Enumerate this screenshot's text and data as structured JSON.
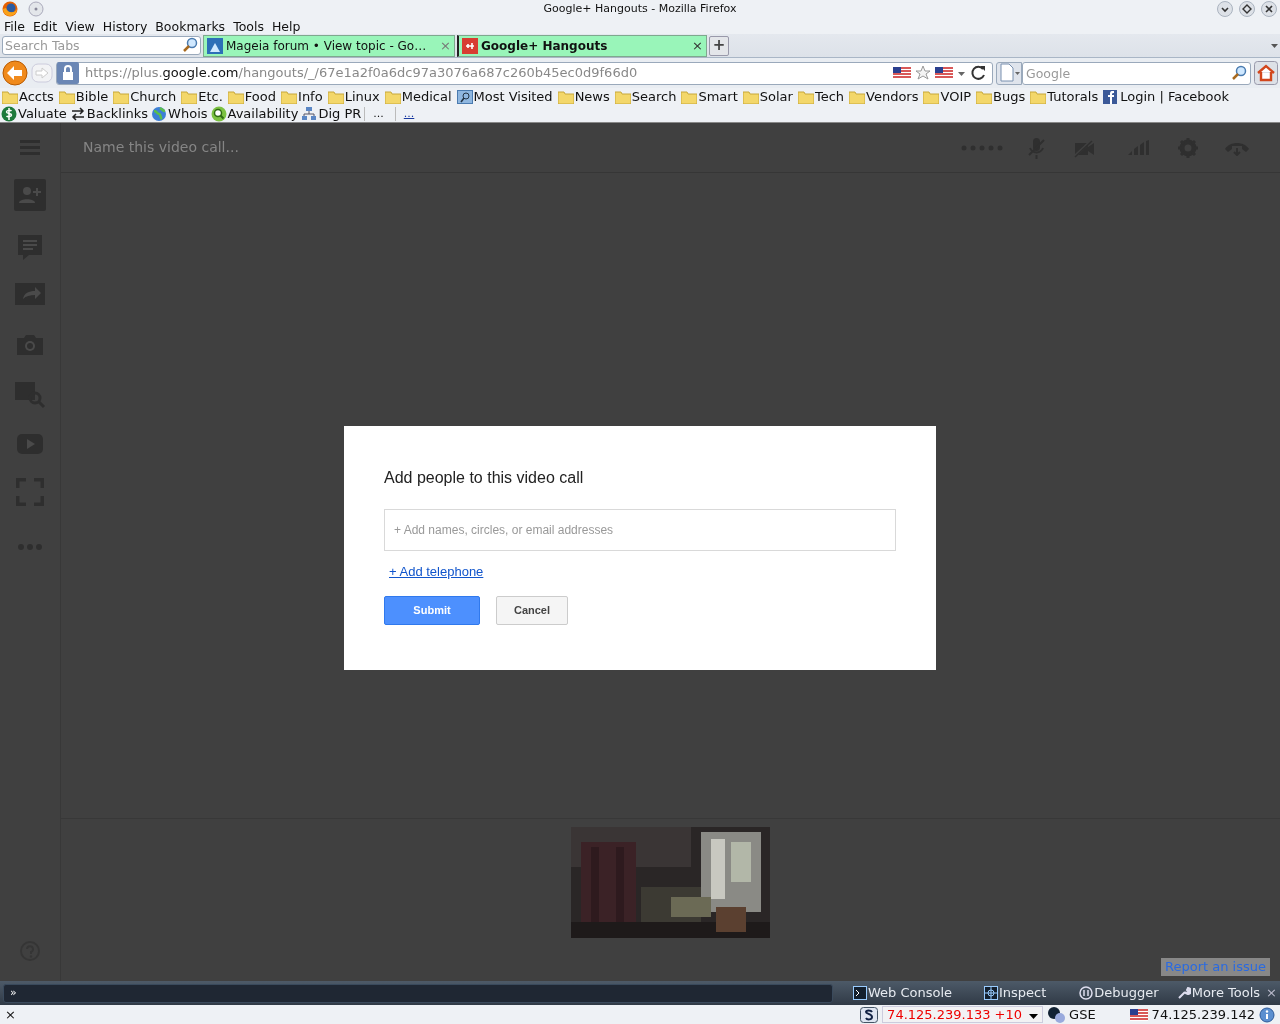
{
  "window": {
    "title": "Google+ Hangouts - Mozilla Firefox"
  },
  "menu": [
    "File",
    "Edit",
    "View",
    "History",
    "Bookmarks",
    "Tools",
    "Help"
  ],
  "tab_search": {
    "placeholder": "Search Tabs"
  },
  "tabs": [
    {
      "label": "Mageia forum • View topic - Go…",
      "close": "×",
      "selected": false
    },
    {
      "label": "Google+ Hangouts",
      "close": "×",
      "selected": true
    }
  ],
  "new_tab": "+",
  "address": {
    "prefix": "https://plus.",
    "domain": "google.com",
    "path": "/hangouts/_/67e1a2f0a6dc97a3076a687c260b45ec0d9f66d0"
  },
  "web_search": {
    "placeholder": "Google"
  },
  "bookmarks": [
    {
      "label": "Accts",
      "kind": "folder"
    },
    {
      "label": "Bible",
      "kind": "folder"
    },
    {
      "label": "Church",
      "kind": "folder"
    },
    {
      "label": "Etc.",
      "kind": "folder"
    },
    {
      "label": "Food",
      "kind": "folder"
    },
    {
      "label": "Info",
      "kind": "folder"
    },
    {
      "label": "Linux",
      "kind": "folder"
    },
    {
      "label": "Medical",
      "kind": "folder"
    },
    {
      "label": "Most Visited",
      "kind": "smart"
    },
    {
      "label": "News",
      "kind": "folder"
    },
    {
      "label": "Search",
      "kind": "folder"
    },
    {
      "label": "Smart",
      "kind": "folder"
    },
    {
      "label": "Solar",
      "kind": "folder"
    },
    {
      "label": "Tech",
      "kind": "folder"
    },
    {
      "label": "Vendors",
      "kind": "folder"
    },
    {
      "label": "VOIP",
      "kind": "folder"
    },
    {
      "label": "Bugs",
      "kind": "folder"
    },
    {
      "label": "Tutorals",
      "kind": "folder"
    },
    {
      "label": "Login | Facebook",
      "kind": "site"
    }
  ],
  "seo_tools": [
    {
      "label": "Valuate",
      "kind": "dollar"
    },
    {
      "label": "Backlinks",
      "kind": "swap"
    },
    {
      "label": "Whois",
      "kind": "globe"
    },
    {
      "label": "Availability",
      "kind": "magnifier"
    },
    {
      "label": "Dig PR",
      "kind": "network"
    }
  ],
  "overflow": [
    "...",
    "..."
  ],
  "hangout": {
    "call_name": {
      "placeholder": "Name this video call..."
    },
    "dialog": {
      "title": "Add people to this video call",
      "field": {
        "placeholder": "+ Add names, circles, or email addresses"
      },
      "link": "+ Add telephone",
      "buttons": [
        {
          "label": "Submit",
          "kind": "primary"
        },
        {
          "label": "Cancel",
          "kind": "secondary"
        }
      ]
    },
    "report": "Report an issue"
  },
  "devtools": {
    "prompt": "»",
    "buttons": [
      {
        "label": "Web Console",
        "kind": "console"
      },
      {
        "label": "Inspect",
        "kind": "inspect"
      },
      {
        "label": "Debugger",
        "kind": "debugger"
      },
      {
        "label": "More Tools",
        "kind": "tools"
      }
    ],
    "close": "×"
  },
  "status_bar": {
    "close": "×",
    "ip": "74.125.239.133 +10",
    "gse": "GSE",
    "server_ip": "74.125.239.142"
  }
}
